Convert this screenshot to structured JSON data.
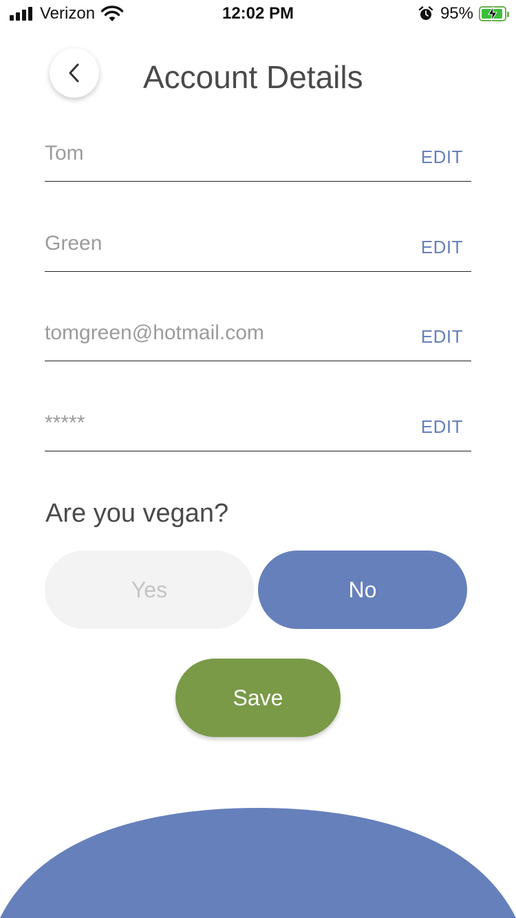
{
  "status_bar": {
    "carrier": "Verizon",
    "time": "12:02 PM",
    "battery_percent": "95%",
    "battery_level": 0.95,
    "icons": [
      "signal-icon",
      "wifi-icon",
      "alarm-icon",
      "battery-charging-icon"
    ]
  },
  "header": {
    "title": "Account Details",
    "back_icon": "chevron-left-icon"
  },
  "fields": [
    {
      "value": "Tom",
      "action": "EDIT"
    },
    {
      "value": "Green",
      "action": "EDIT"
    },
    {
      "value": "tomgreen@hotmail.com",
      "action": "EDIT"
    },
    {
      "value": "*****",
      "action": "EDIT"
    }
  ],
  "vegan": {
    "question": "Are you vegan?",
    "yes_label": "Yes",
    "no_label": "No",
    "selected": "No"
  },
  "save_label": "Save",
  "colors": {
    "accent_blue": "#6680bb",
    "save_green": "#7a9a48",
    "unselected_bg": "#f3f3f3",
    "text_dark": "#4a4a4a",
    "text_muted": "#9b9b9b"
  }
}
